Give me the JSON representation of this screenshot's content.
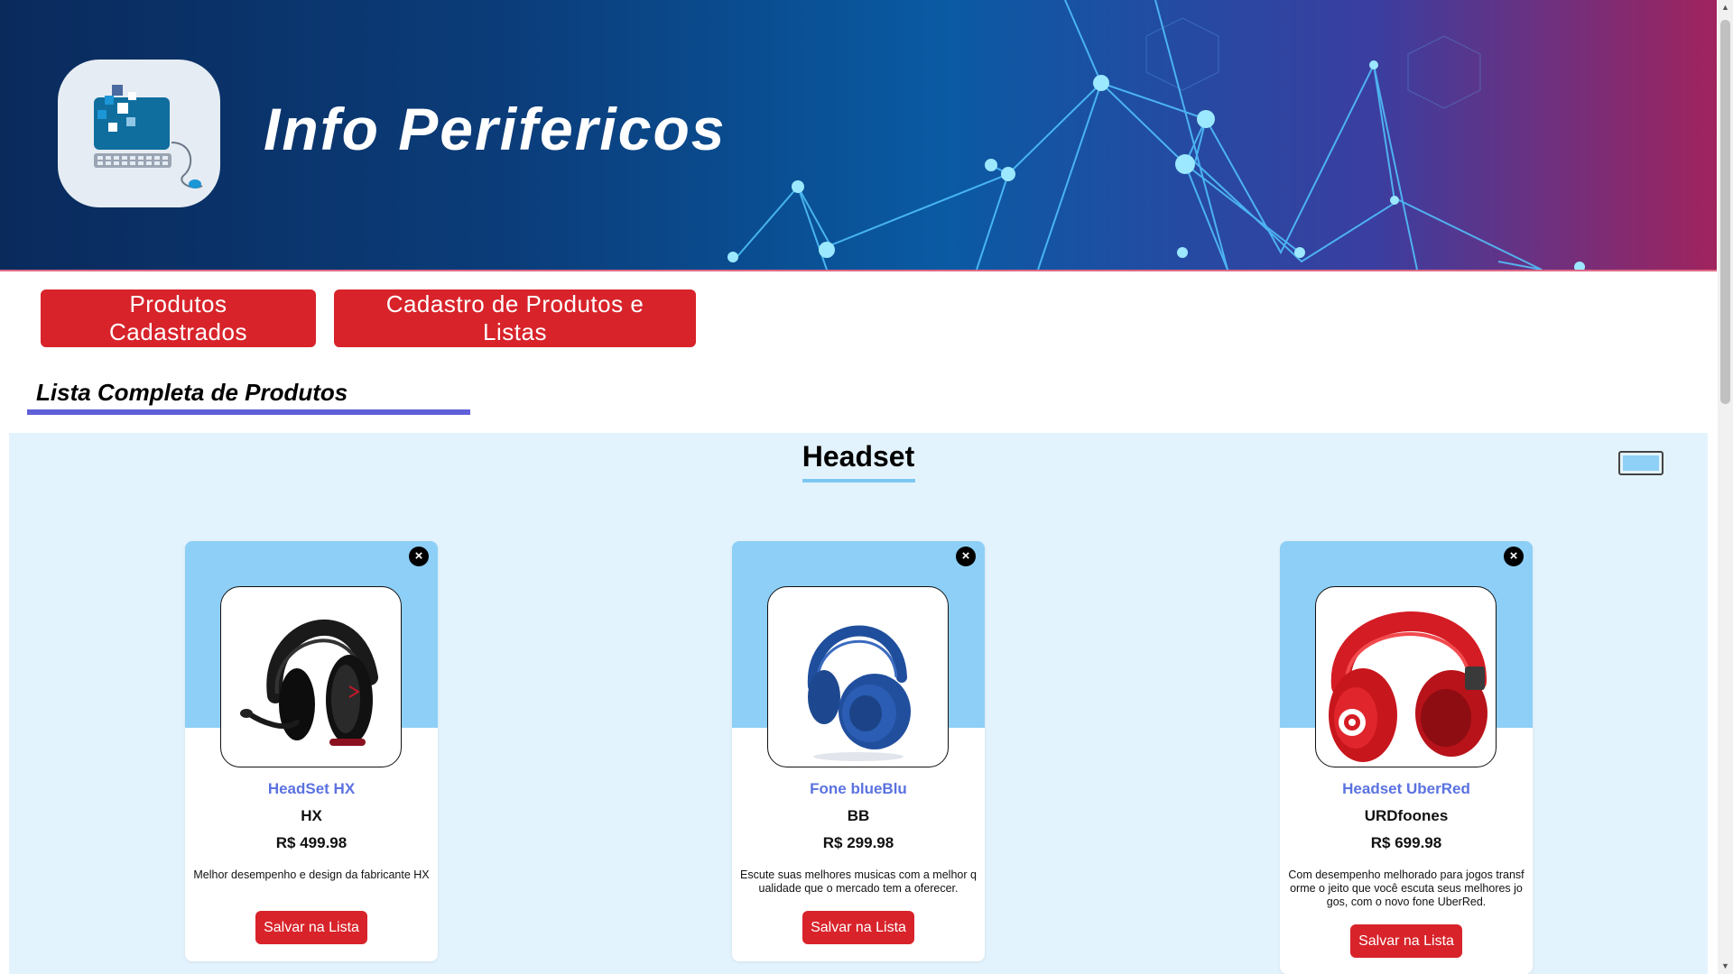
{
  "header": {
    "site_title": "Info Perifericos",
    "logo_icon": "computer-keyboard-mouse-icon"
  },
  "nav": {
    "registered_products_label": "Produtos Cadastrados",
    "register_products_lists_label": "Cadastro de Produtos e Listas"
  },
  "section": {
    "title": "Lista Completa de Produtos"
  },
  "category": {
    "title": "Headset"
  },
  "products": [
    {
      "name": "HeadSet HX",
      "brand": "HX",
      "price": "R$ 499.98",
      "description": "Melhor desempenho e design da fabricante HX",
      "save_label": "Salvar na Lista",
      "close_label": "×",
      "image_icon": "black-gaming-headset-image"
    },
    {
      "name": "Fone blueBlu",
      "brand": "BB",
      "price": "R$ 299.98",
      "description": "Escute suas melhores musicas com a melhor qualidade que o mercado tem a oferecer.",
      "save_label": "Salvar na Lista",
      "close_label": "×",
      "image_icon": "blue-headphones-image"
    },
    {
      "name": "Headset UberRed",
      "brand": "URDfoones",
      "price": "R$ 699.98",
      "description": "Com desempenho melhorado para jogos transforme o jeito que você escuta seus melhores jogos, com o novo fone UberRed.",
      "save_label": "Salvar na Lista",
      "close_label": "×",
      "image_icon": "red-headphones-image"
    }
  ],
  "colors": {
    "accent_red": "#d8232a",
    "card_top_blue": "#8dcff6",
    "panel_bg": "#e3f3fd",
    "product_name_blue": "#5b72e0",
    "section_underline": "#5f5fd8"
  }
}
